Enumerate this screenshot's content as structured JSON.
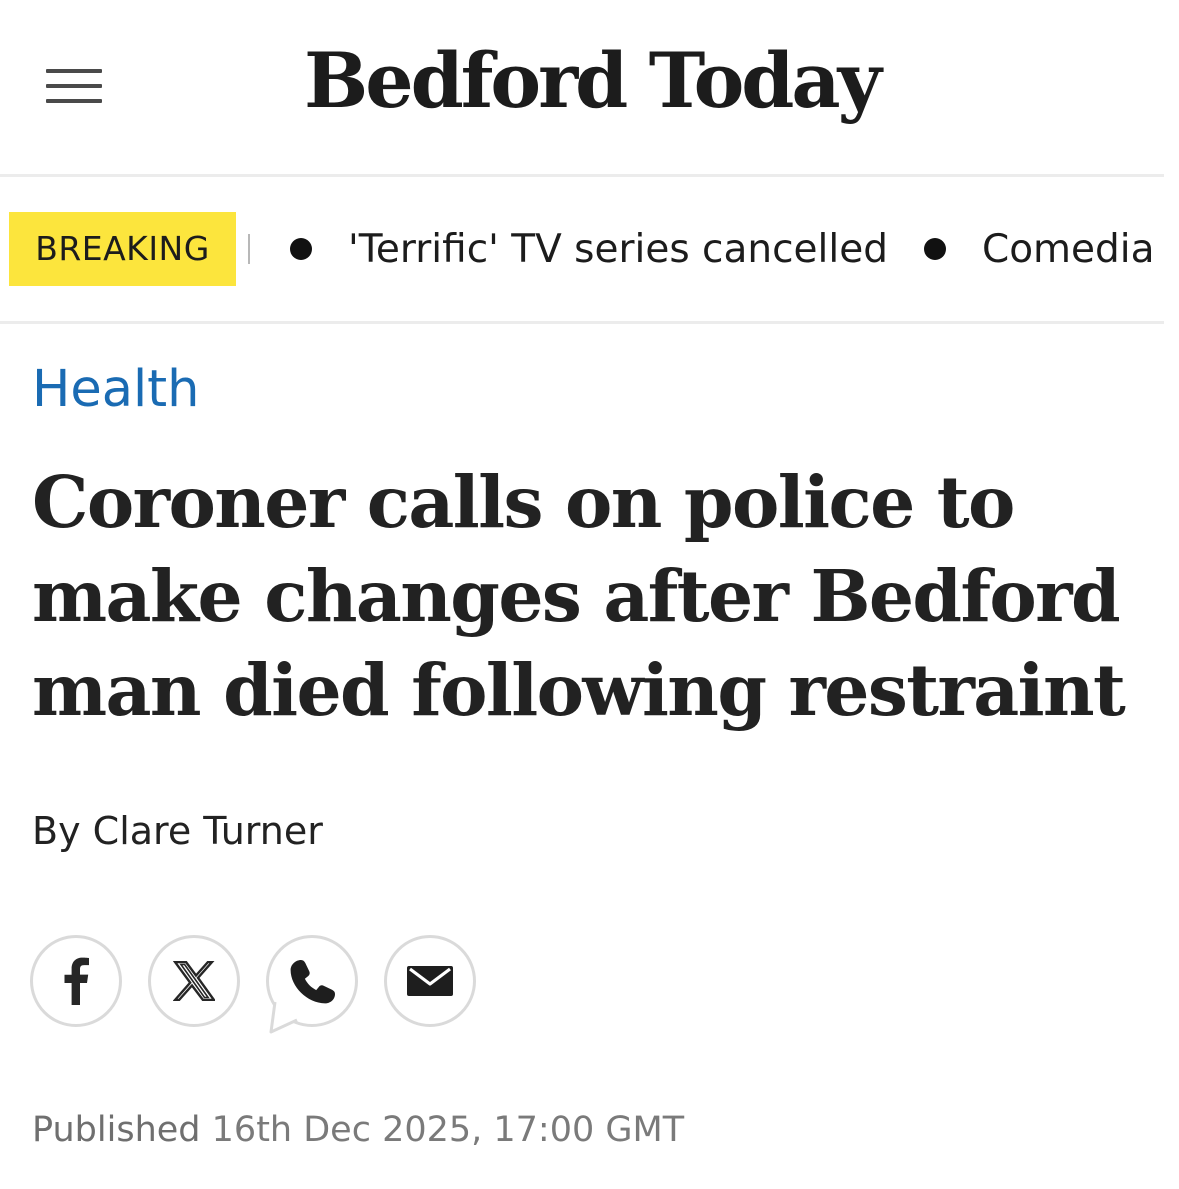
{
  "header": {
    "site_name": "Bedford Today",
    "menu_icon": "hamburger-menu-icon"
  },
  "breaking": {
    "label": "BREAKING",
    "label_color": "#fce53d",
    "items": [
      "'Terrific' TV series cancelled",
      "Comedia"
    ]
  },
  "article": {
    "category": "Health",
    "category_color": "#1a6bb3",
    "headline": "Coroner calls on police to make changes after Bedford man died following restraint",
    "byline_prefix": "By",
    "author": "Clare Turner",
    "share": [
      {
        "name": "facebook",
        "icon": "facebook-icon"
      },
      {
        "name": "x",
        "icon": "x-icon"
      },
      {
        "name": "whatsapp",
        "icon": "whatsapp-icon"
      },
      {
        "name": "email",
        "icon": "email-icon"
      }
    ],
    "published_label": "Published",
    "published_date": "16th Dec 2025, 17:00 GMT"
  }
}
